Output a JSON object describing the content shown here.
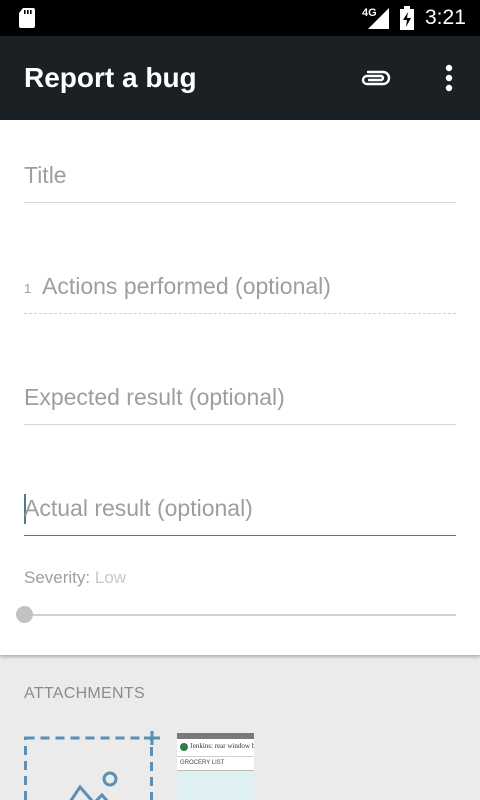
{
  "status_bar": {
    "network_type": "4G",
    "time": "3:21",
    "icons": [
      "sd-card-icon",
      "signal-icon",
      "battery-charging-icon"
    ]
  },
  "app_bar": {
    "title": "Report a bug",
    "actions": [
      "attach-icon",
      "more-vert-icon"
    ]
  },
  "form": {
    "title_placeholder": "Title",
    "actions": {
      "step_number": "1",
      "placeholder": "Actions performed (optional)"
    },
    "expected_placeholder": "Expected result (optional)",
    "actual_placeholder": "Actual result (optional)",
    "severity": {
      "label": "Severity:",
      "value": "Low",
      "slider_fraction": 0
    }
  },
  "attachments": {
    "heading": "ATTACHMENTS",
    "add_icon": "add-image-icon",
    "thumbnail": {
      "title": "Jenkins: rear window bug? N",
      "subtitle": "GROCERY LIST"
    }
  },
  "colors": {
    "status_bar": "#000000",
    "app_bar": "#1b2024",
    "accent": "#4a7d86",
    "hint_text": "#9e9e9e",
    "attachments_bg": "#ebebeb",
    "dashed_border": "#5b8fb4"
  }
}
